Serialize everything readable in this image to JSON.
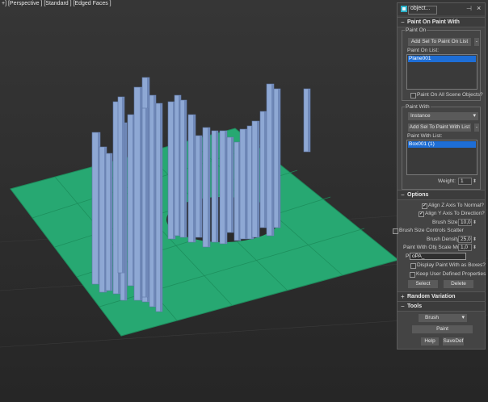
{
  "viewport": {
    "label": "+] [Perspective ] [Standard ] [Edged Faces ]",
    "background": "#2e2e2e",
    "plane_color": "#27a872",
    "object_color": "#8ea8d4"
  },
  "panel": {
    "window_title": "object...",
    "paint_on_paint_with": {
      "header": "Paint On Paint With",
      "paint_on_label": "Paint On",
      "add_sel_paint_on_label": "Add Sel To Paint On List",
      "paint_on_list_label": "Paint On List:",
      "paint_on_list_items": [
        "Plane001"
      ],
      "paint_on_all_label": "Paint On All Scene Objects?",
      "paint_with_label": "Paint With",
      "paint_with_mode": "Instance",
      "add_sel_paint_with_label": "Add Sel To Paint With List",
      "paint_with_list_label": "Paint With List:",
      "paint_with_list_items": [
        "Box001 (1)"
      ],
      "weight_label": "Weight:",
      "weight_value": "1"
    },
    "options": {
      "header": "Options",
      "align_z_label": "Align Z Axis To Normal?",
      "align_z_checked": true,
      "align_y_label": "Align Y Axis To Direction?",
      "align_y_checked": true,
      "brush_size_label": "Brush Size:",
      "brush_size_value": "10,0",
      "brush_scatter_label": "Brush Size Controls Scatter",
      "brush_density_label": "Brush Density:",
      "brush_density_value": "25,0",
      "scale_mult_label": "Paint With Obj Scale Mult:",
      "scale_mult_value": "1,0",
      "prefix_label": "Prefix:",
      "prefix_value": "oPA_",
      "display_boxes_label": "Display Paint With as Boxes?",
      "keep_props_label": "Keep User Defined Properties",
      "select_label": "Select",
      "delete_label": "Delete"
    },
    "random_variation": {
      "header": "Random Variation"
    },
    "tools": {
      "header": "Tools",
      "mode_value": "Brush",
      "paint_label": "Paint",
      "help_label": "Help",
      "savedef_label": "SaveDef"
    }
  }
}
